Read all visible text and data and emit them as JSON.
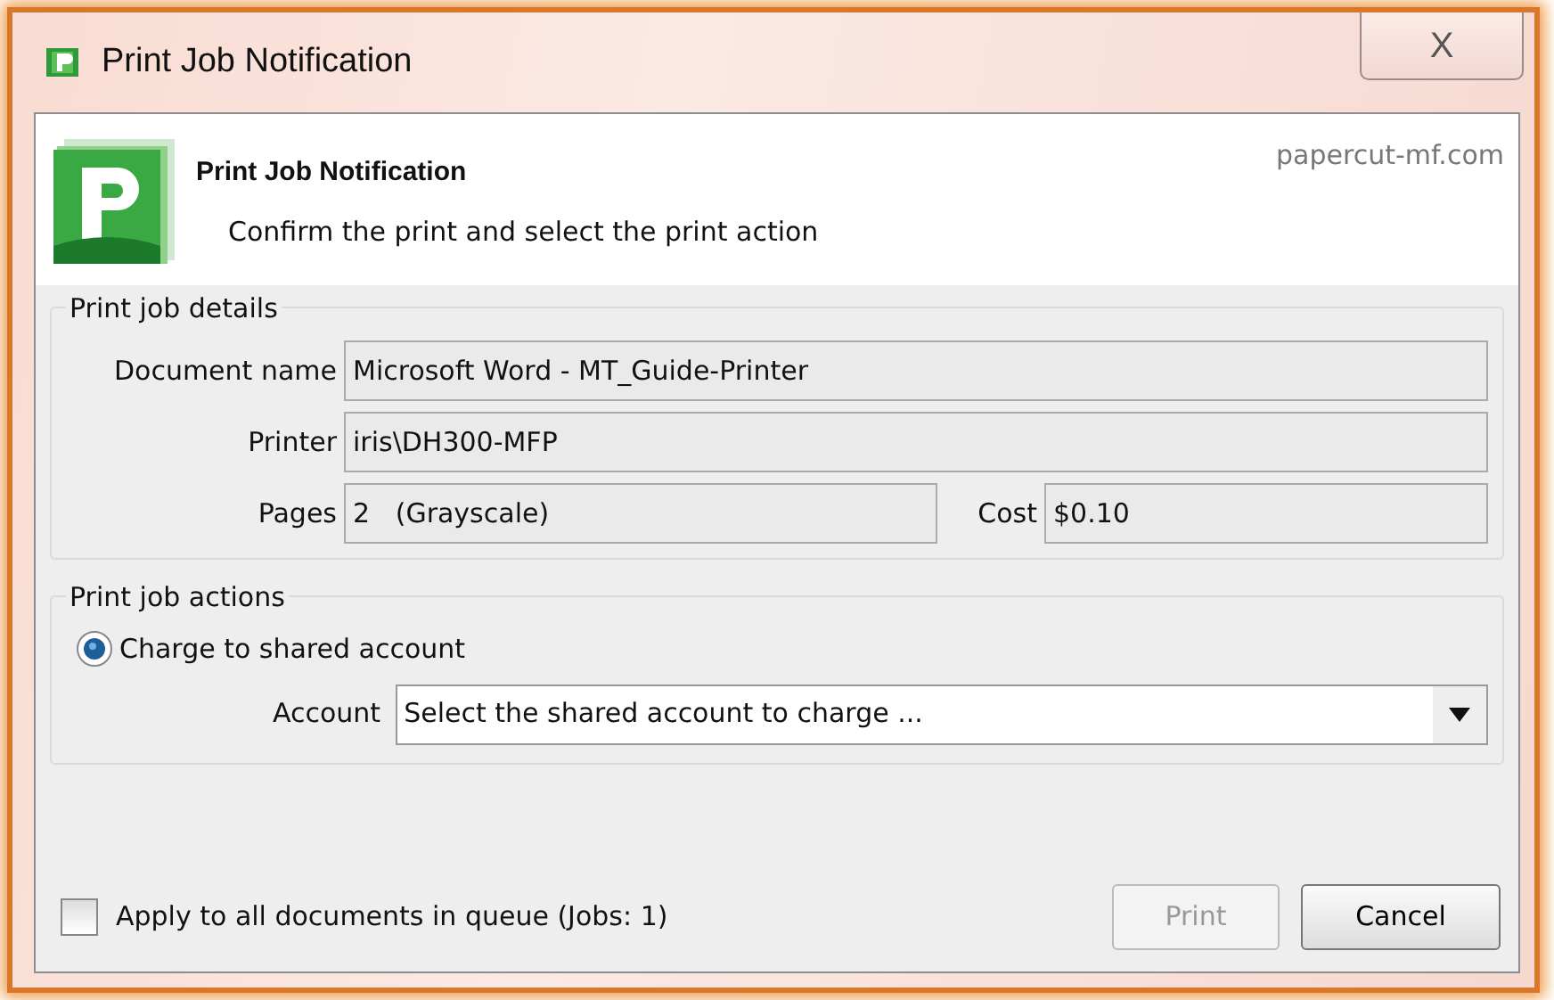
{
  "window": {
    "title": "Print Job Notification",
    "close": "X"
  },
  "header": {
    "title": "Print Job Notification",
    "subtitle": "Confirm the print and select the print action",
    "site": "papercut-mf.com"
  },
  "details": {
    "legend": "Print job details",
    "fields": [
      {
        "label": "Document name",
        "value": "Microsoft Word - MT_Guide-Printer"
      },
      {
        "label": "Printer",
        "value": "iris\\DH300-MFP"
      },
      {
        "label": "Pages",
        "value": "2   (Grayscale)"
      },
      {
        "label": "Cost",
        "value": "$0.10"
      }
    ]
  },
  "actions": {
    "legend": "Print job actions",
    "radio": {
      "label": "Charge to shared account",
      "selected": true
    },
    "account": {
      "label": "Account",
      "value": "Select the shared account to charge ..."
    }
  },
  "apply": {
    "label": "Apply to all documents in queue (Jobs: 1)",
    "checked": false
  },
  "buttons": [
    {
      "label": "Print",
      "disabled": true
    },
    {
      "label": "Cancel",
      "disabled": false
    }
  ]
}
